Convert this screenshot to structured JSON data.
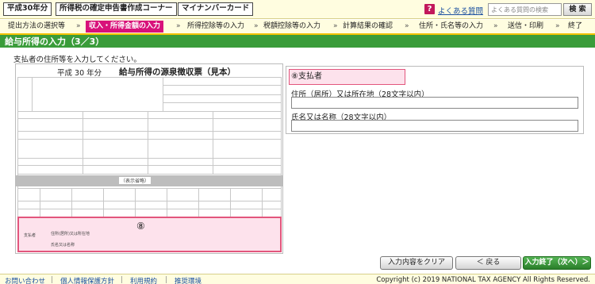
{
  "header": {
    "year_button": "平成30年分",
    "corner_button": "所得税の確定申告書作成コーナー",
    "mynumber_button": "マイナンバーカード",
    "faq_icon": "?",
    "faq_link": "よくある質問",
    "search_placeholder": "よくある質問の検索",
    "search_button": "検 索"
  },
  "steps": {
    "items": [
      "提出方法の選択等",
      "収入・所得金額の入力",
      "所得控除等の入力",
      "税額控除等の入力",
      "計算結果の確認",
      "住所・氏名等の入力",
      "送信・印刷",
      "終了"
    ],
    "separator": "»",
    "active_index": 1
  },
  "page": {
    "title": "給与所得の入力（3／3）",
    "instruction": "支払者の住所等を入力してください。"
  },
  "form_image": {
    "year_label": "平成 30 年分",
    "title": "給与所得の源泉徴収票（見本）",
    "omitted_label": "（表示省略）",
    "highlight_number": "⑧",
    "payer_label": "支払者",
    "address_label": "住所(居所)又は所在地",
    "name_label": "氏名又は名称"
  },
  "payer_panel": {
    "header": "⑧支払者",
    "address_label": "住所（居所）又は所在地（28文字以内）",
    "address_value": "",
    "name_label": "氏名又は名称（28文字以内）",
    "name_value": ""
  },
  "actions": {
    "clear": "入力内容をクリア",
    "back": "＜ 戻る",
    "next": "入力終了（次へ）＞"
  },
  "footer": {
    "links": [
      "お問い合わせ",
      "個人情報保護方針",
      "利用規約",
      "推奨環境"
    ],
    "separator": "|",
    "copyright": "Copyright (c) 2019 NATIONAL TAX AGENCY All Rights Reserved."
  },
  "colors": {
    "active_step": "#d8117a",
    "title_bar": "#3a9c3a",
    "highlight_pink": "#fde2ec",
    "highlight_border": "#e2567d",
    "next_button": "#2a7e2a"
  }
}
